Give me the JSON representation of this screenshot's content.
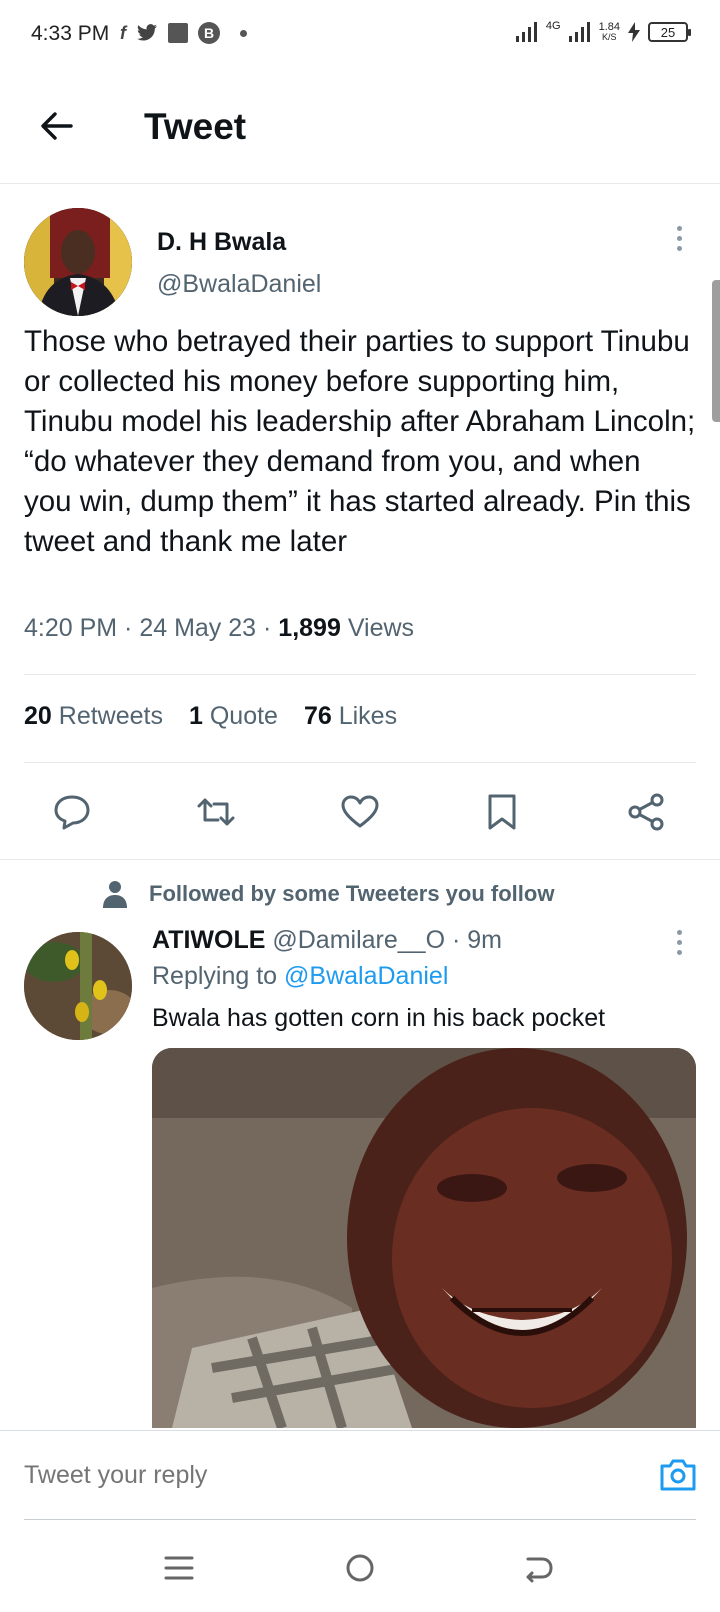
{
  "status_bar": {
    "time": "4:33 PM",
    "network": "4G",
    "speed_value": "1.84",
    "speed_unit": "K/S",
    "battery": "25"
  },
  "header": {
    "title": "Tweet",
    "back_icon": "arrow-left-icon"
  },
  "tweet": {
    "author_name": "D. H Bwala",
    "author_handle": "@BwalaDaniel",
    "text": "Those who betrayed their parties to support Tinubu or collected his money before supporting him, Tinubu model his leadership after Abraham Lincoln; “do whatever they demand from you, and when you win, dump them” it has started already. Pin this tweet and thank me later",
    "time": "4:20 PM",
    "date": "24 May 23",
    "views_count": "1,899",
    "views_label": "Views",
    "retweets_count": "20",
    "retweets_label": "Retweets",
    "quotes_count": "1",
    "quotes_label": "Quote",
    "likes_count": "76",
    "likes_label": "Likes"
  },
  "actions": [
    "reply-icon",
    "retweet-icon",
    "like-icon",
    "bookmark-icon",
    "share-icon"
  ],
  "reply": {
    "context": "Followed by some Tweeters you follow",
    "author_name": "ATIWOLE",
    "author_handle": "@Damilare__O",
    "time": "9m",
    "replying_prefix": "Replying to",
    "replying_to": "@BwalaDaniel",
    "text": "Bwala has gotten corn in his back pocket"
  },
  "composer": {
    "placeholder": "Tweet your reply"
  },
  "colors": {
    "accent": "#1d9bf0",
    "secondary_text": "#536471",
    "primary_text": "#0f1419"
  }
}
